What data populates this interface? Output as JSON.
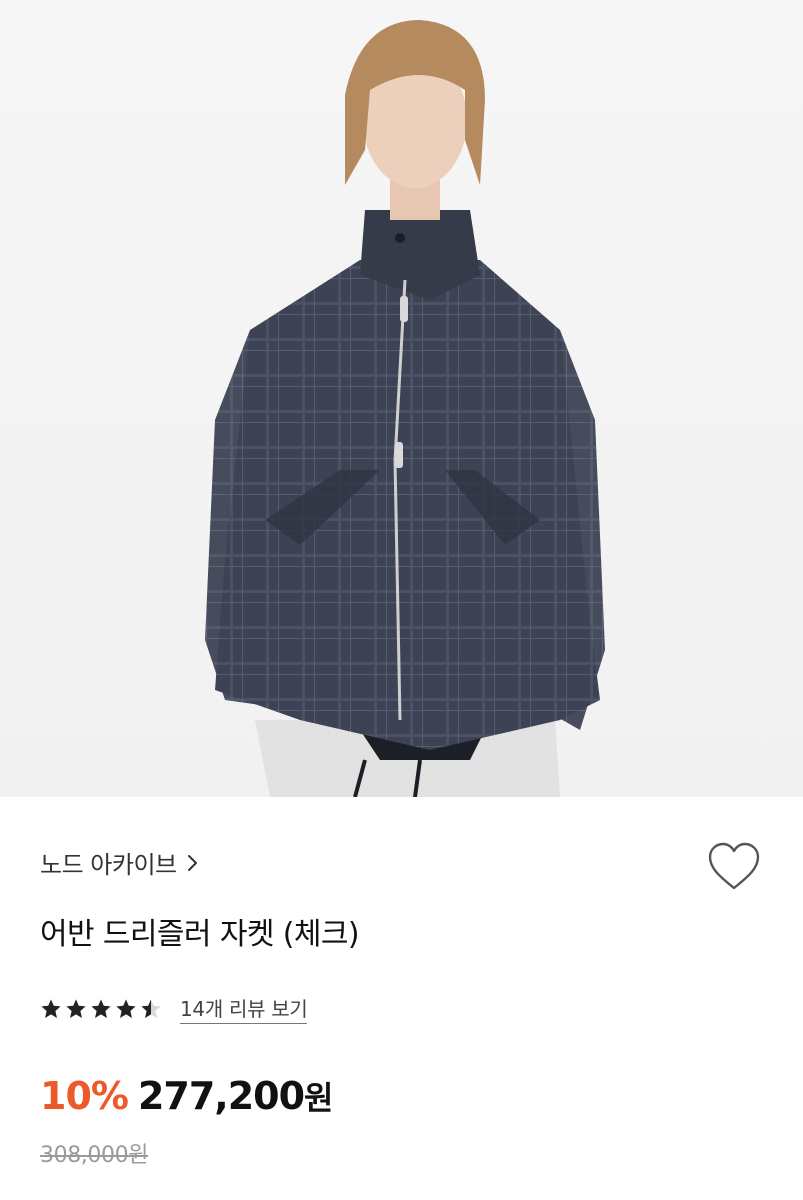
{
  "product": {
    "image_alt": "model wearing navy check jacket",
    "brand": "노드 아카이브",
    "title": "어반 드리즐러 자켓 (체크)",
    "rating": 4.5,
    "review_link": "14개 리뷰 보기",
    "discount": "10%",
    "price": "277,200",
    "price_unit": "원",
    "original_price": "308,000원"
  },
  "icons": {
    "brand_chevron": "chevron-right-icon",
    "like": "heart-outline-icon",
    "star": "star-icon"
  },
  "colors": {
    "discount": "#ec5a2a",
    "star": "#222222",
    "muted": "#9a9a9a"
  }
}
